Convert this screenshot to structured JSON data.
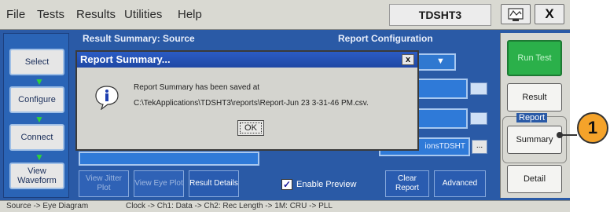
{
  "menu": {
    "items": [
      "File",
      "Tests",
      "Results",
      "Utilities",
      "Help"
    ],
    "model": "TDSHT3",
    "close_label": "X"
  },
  "left_panel": {
    "buttons": [
      "Select",
      "Configure",
      "Connect",
      "View Waveform"
    ],
    "arrow_icon": "down-arrow-icon"
  },
  "main": {
    "result_title": "Result Summary: Source",
    "config_title": "Report Configuration",
    "path_value": "ionsTDSHT",
    "browse_label": "...",
    "bottom_buttons": {
      "jitter": "View Jitter Plot",
      "eye": "View Eye Plot",
      "details": "Result Details",
      "clear": "Clear Report",
      "advanced": "Advanced"
    },
    "enable_preview": "Enable Preview",
    "enable_preview_checked": true
  },
  "right_panel": {
    "run_test": "Run Test",
    "result": "Result",
    "report_label": "Report",
    "summary": "Summary",
    "detail": "Detail"
  },
  "dialog": {
    "title": "Report Summary...",
    "close": "x",
    "message_line1": "Report Summary has been saved at",
    "message_line2": "C:\\TekApplications\\TDSHT3\\reports\\Report-Jun 23 3-31-46 PM.csv.",
    "ok_label": "OK",
    "icon": "info-icon"
  },
  "status": {
    "left": "Source -> Eye Diagram",
    "right": "Clock -> Ch1: Data -> Ch2: Rec Length -> 1M: CRU -> PLL"
  },
  "callout": {
    "number": "1"
  },
  "colors": {
    "app_bg": "#2a5aa6",
    "menu_bg": "#d9d9d2",
    "run_green": "#2bb04a",
    "callout": "#f5a32a"
  }
}
